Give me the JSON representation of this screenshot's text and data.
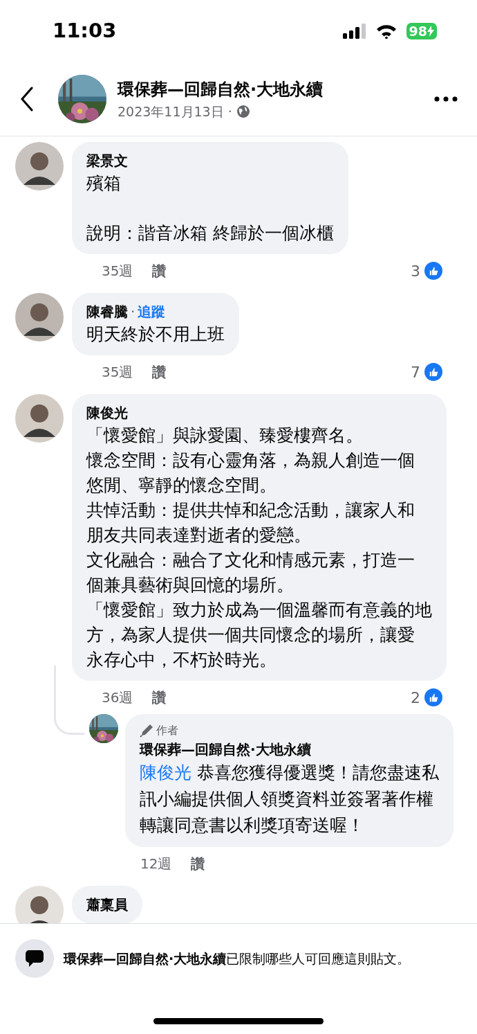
{
  "status_bar": {
    "time": "11:03",
    "battery": "98"
  },
  "header": {
    "title": "環保葬—回歸自然·大地永續",
    "date": "2023年11月13日 ·"
  },
  "comments": [
    {
      "name": "梁景文",
      "spaced": true,
      "lines": [
        "殯箱",
        "說明：諧音冰箱 終歸於一個冰櫃"
      ],
      "time": "35週",
      "like": "讚",
      "reactions": "3"
    },
    {
      "name": "陳睿騰",
      "follow_separator": "·",
      "follow": "追蹤",
      "lines": [
        "明天終於不用上班"
      ],
      "time": "35週",
      "like": "讚",
      "reactions": "7"
    },
    {
      "name": "陳俊光",
      "lines": [
        "「懷愛館」與詠愛園、臻愛樓齊名。",
        "懷念空間：設有心靈角落，為親人創造一個",
        "悠閒、寧靜的懷念空間。",
        "共悼活動：提供共悼和紀念活動，讓家人和",
        "朋友共同表達對逝者的愛戀。",
        "文化融合：融合了文化和情感元素，打造一",
        "個兼具藝術與回憶的場所。",
        "「懷愛館」致力於成為一個溫馨而有意義的地",
        "方，為家人提供一個共同懷念的場所，讓愛",
        "永存心中，不朽於時光。"
      ],
      "time": "36週",
      "like": "讚",
      "reactions": "2",
      "replies": [
        {
          "badge": "作者",
          "name": "環保葬—回歸自然·大地永續",
          "mention": "陳俊光",
          "lines": [
            "恭喜您獲得優選獎！請您盡速私",
            "訊小編提供個人領獎資料並簽署著作權",
            "轉讓同意書以利獎項寄送喔！"
          ],
          "time": "12週",
          "like": "讚"
        }
      ]
    },
    {
      "name": "蕭稟員"
    }
  ],
  "footer": {
    "notice": "**環保葬—回歸自然·大地永續**已限制哪些人可回應這則貼文。"
  }
}
